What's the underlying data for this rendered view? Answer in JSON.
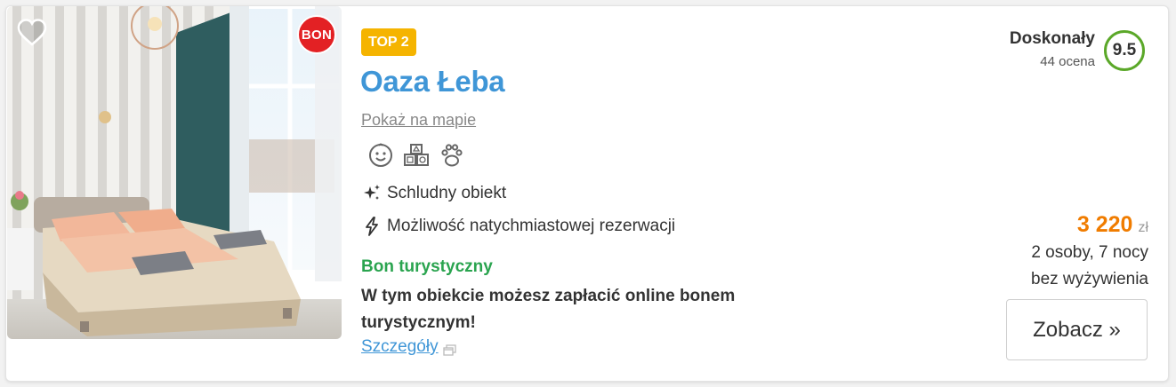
{
  "offer": {
    "bon_badge": "BON",
    "top_badge": "TOP 2",
    "title": "Oaza Łeba",
    "map_link": "Pokaż na mapie",
    "amenities": [
      "child-friendly-icon",
      "kids-play-icon",
      "pets-allowed-icon"
    ],
    "features": [
      {
        "icon": "sparkles-icon",
        "text": "Schludny obiekt"
      },
      {
        "icon": "lightning-icon",
        "text": "Możliwość natychmiastowej rezerwacji"
      }
    ],
    "bon": {
      "title": "Bon turystyczny",
      "description": "W tym obiekcie możesz zapłacić online bonem turystycznym!",
      "details_link": "Szczegóły"
    },
    "rating": {
      "label": "Doskonały",
      "count": "44 ocena",
      "score": "9.5"
    },
    "price": {
      "amount": "3 220",
      "currency": "zł",
      "guests_nights": "2 osoby, 7 nocy",
      "board": "bez wyżywienia"
    },
    "see_button": "Zobacz »"
  },
  "colors": {
    "accent_blue": "#3f96d7",
    "top_badge": "#f5b400",
    "bon_badge": "#e32124",
    "bon_green": "#2aa44f",
    "price_orange": "#f07c00",
    "score_ring": "#5ba829"
  }
}
